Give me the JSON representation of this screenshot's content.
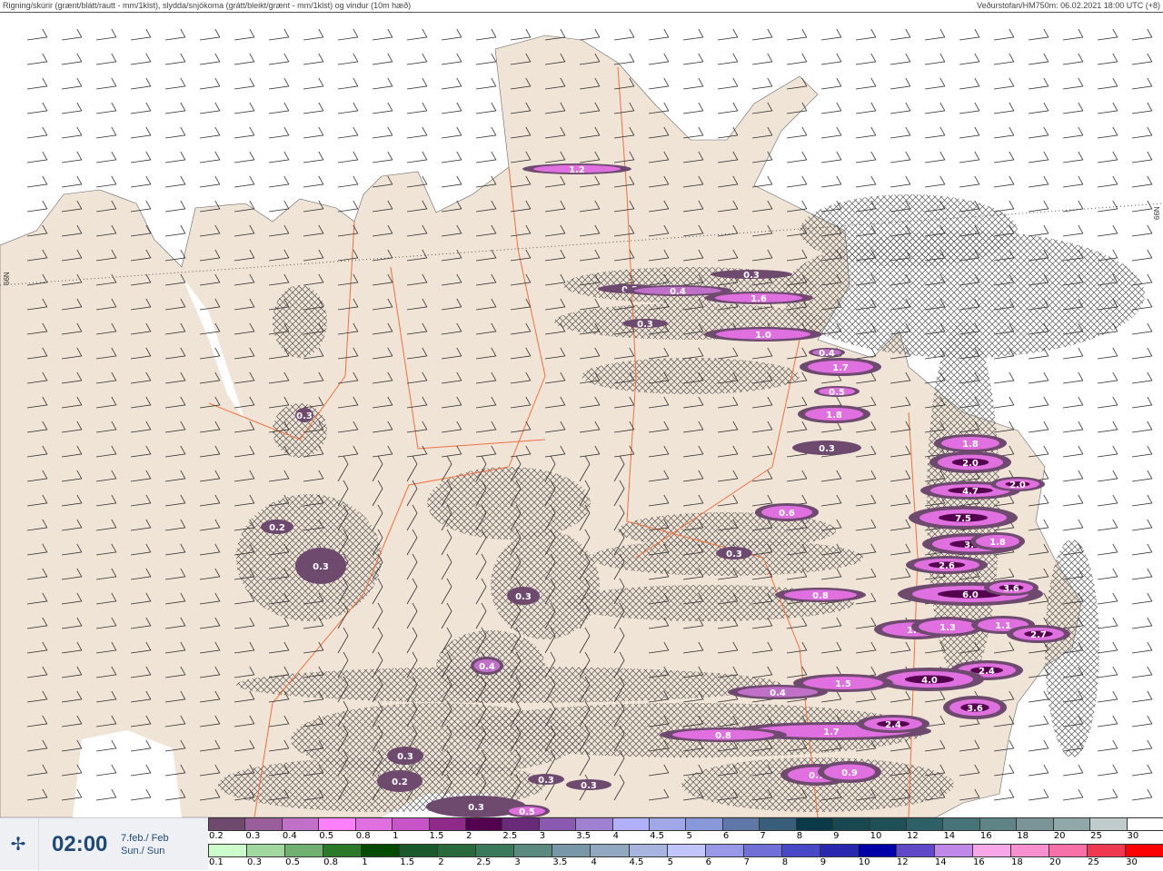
{
  "header": {
    "title": "Rigning/skúrir (grænt/blátt/rautt - mm/1klst), slydda/snjókoma (grátt/bleikt/grænt - mm/1klst) og vindur (10m hæð)",
    "source": "Veðurstofan/HM750m: 06.02.2021 18:00 UTC (+8)"
  },
  "map": {
    "lat_label": "66N",
    "land_color": "#f0e4d6",
    "sea_color": "#ffffff",
    "border_color": "#f07040",
    "labels": [
      "1.2",
      "0.3",
      "0.3",
      "0.4",
      "1.6",
      "0.3",
      "1.0",
      "1.7",
      "0.5",
      "1.8",
      "0.3",
      "1.8",
      "2.0",
      "4.7",
      "2.0",
      "7.5",
      "0.6",
      "0.3",
      "3.4",
      "1.8",
      "2.6",
      "0.8",
      "6.0",
      "3.6",
      "1.7",
      "1.3",
      "1.1",
      "2.7",
      "2.4",
      "4.0",
      "1.5",
      "0.4",
      "3.6",
      "1.7",
      "2.4",
      "0.8",
      "0.7",
      "0.9",
      "0.3",
      "0.2",
      "0.3",
      "0.4",
      "0.3",
      "0.2",
      "0.3",
      "0.3",
      "0.3",
      "0.5",
      "0.4",
      "0.3"
    ]
  },
  "time": {
    "icon": "wind-rose-icon",
    "time": "02:00",
    "date": "7.feb./ Feb",
    "day": "Sun./ Sun"
  },
  "legend": {
    "snow": {
      "labels": [
        "0.2",
        "0.3",
        "0.4",
        "0.5",
        "0.8",
        "1",
        "1.5",
        "2",
        "2.5",
        "3",
        "3.5",
        "4",
        "4.5",
        "5",
        "6",
        "7",
        "8",
        "9",
        "10",
        "12",
        "14",
        "16",
        "18",
        "20",
        "25",
        "30"
      ],
      "colors": [
        "#6e4a6e",
        "#9a5e9a",
        "#c070c8",
        "#ff80ff",
        "#e070e0",
        "#c855c8",
        "#8f2a8a",
        "#55004f",
        "#6a2a7a",
        "#8a5ab0",
        "#a080d0",
        "#b0b0ff",
        "#a0a8e8",
        "#8898d8",
        "#6078a8",
        "#385e7a",
        "#0a3a48",
        "#184850",
        "#1f5058",
        "#2e6068",
        "#467478",
        "#5e8488",
        "#7a9498",
        "#90a8aa",
        "#c0cccc",
        "#ffffff"
      ]
    },
    "rain": {
      "labels": [
        "0.1",
        "0.3",
        "0.5",
        "0.8",
        "1",
        "1.5",
        "2",
        "2.5",
        "3",
        "3.5",
        "4",
        "4.5",
        "5",
        "6",
        "7",
        "8",
        "9",
        "10",
        "12",
        "14",
        "16",
        "18",
        "20",
        "25",
        "30"
      ],
      "colors": [
        "#ccffcc",
        "#a0d8a0",
        "#70b070",
        "#2a7a2a",
        "#004a00",
        "#1a5a2a",
        "#2a6a3a",
        "#3a7a5a",
        "#5a8a80",
        "#7898a8",
        "#90a8c0",
        "#a8b4e0",
        "#c0c4ff",
        "#9898e8",
        "#7070d8",
        "#4848c8",
        "#2828b0",
        "#0000a8",
        "#6048c8",
        "#c088e8",
        "#f8a8e8",
        "#f890d0",
        "#f870a8",
        "#f03850",
        "#ff0000"
      ]
    }
  }
}
